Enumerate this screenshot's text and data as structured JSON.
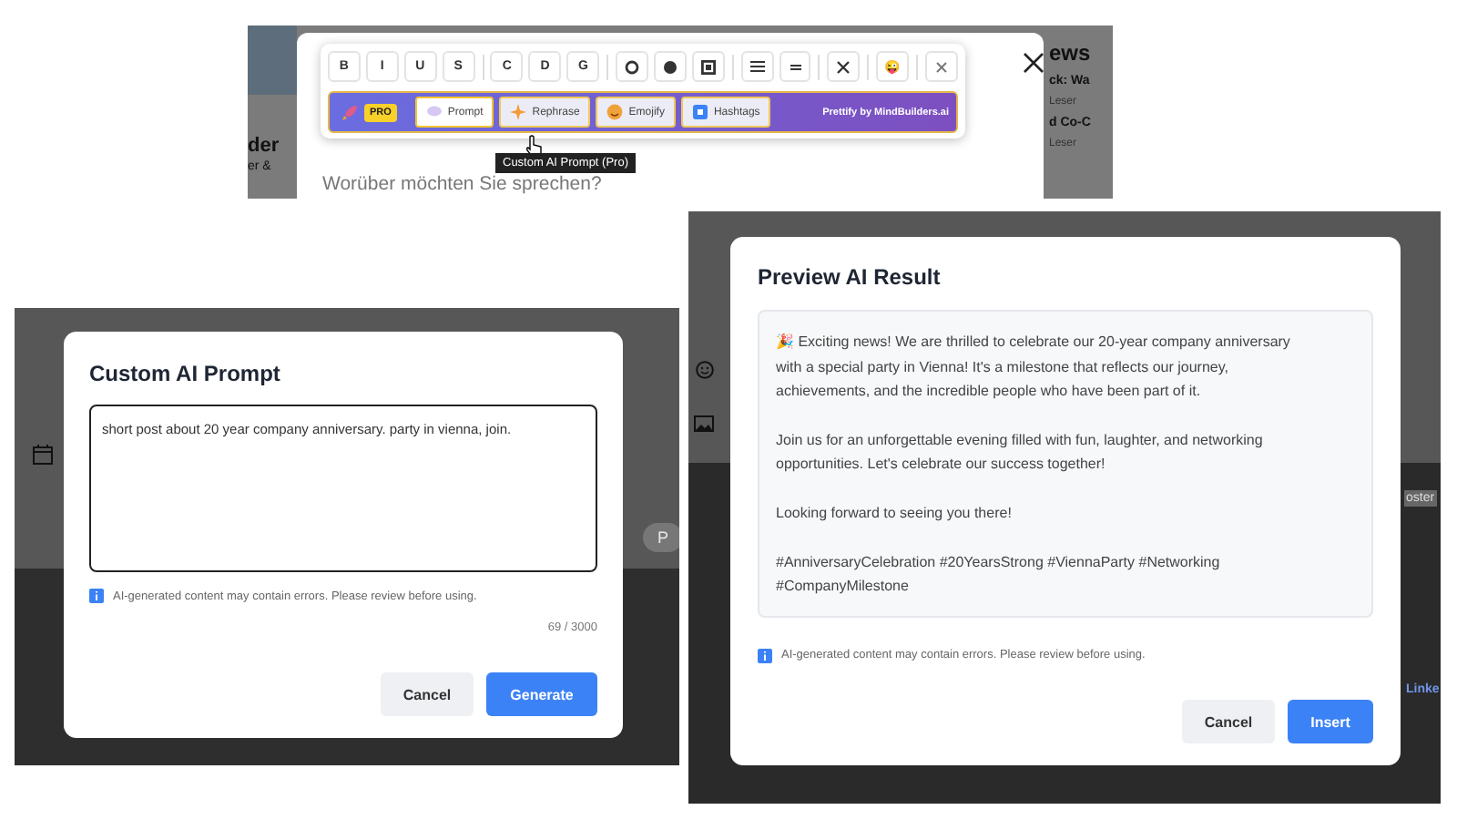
{
  "toolbar_shot": {
    "backdrop_left": [
      "der",
      "er &"
    ],
    "backdrop_right": [
      "ews",
      "ck: Wa",
      "Leser",
      "d Co-C",
      "Leser"
    ],
    "format_groups": [
      [
        {
          "kind": "letter",
          "label": "B"
        },
        {
          "kind": "letter",
          "label": "I"
        },
        {
          "kind": "letter",
          "label": "U"
        },
        {
          "kind": "letter",
          "label": "S"
        }
      ],
      [
        {
          "kind": "letter",
          "label": "C"
        },
        {
          "kind": "letter",
          "label": "D"
        },
        {
          "kind": "letter",
          "label": "G"
        }
      ],
      [
        {
          "kind": "ring"
        },
        {
          "kind": "dot"
        },
        {
          "kind": "square"
        }
      ],
      [
        {
          "kind": "lines"
        },
        {
          "kind": "equals"
        }
      ],
      [
        {
          "kind": "cross"
        }
      ],
      [
        {
          "kind": "emoji",
          "label": "😜"
        }
      ],
      [
        {
          "kind": "close"
        }
      ]
    ],
    "pro_badge": "PRO",
    "ai_buttons": [
      {
        "label": "Prompt",
        "selected": true
      },
      {
        "label": "Rephrase",
        "selected": false
      },
      {
        "label": "Emojify",
        "selected": false
      },
      {
        "label": "Hashtags",
        "selected": false
      }
    ],
    "credit": "Prettify by MindBuilders.ai",
    "tooltip": "Custom AI Prompt (Pro)",
    "placeholder": "Worüber möchten Sie sprechen?"
  },
  "prompt_dialog": {
    "title": "Custom AI Prompt",
    "value": "short post about 20 year company anniversary. party in vienna, join.",
    "note": "AI-generated content may contain errors. Please review before using.",
    "counter": "69 / 3000",
    "backdrop_chip": "P",
    "buttons": [
      {
        "label": "Cancel",
        "kind": "secondary"
      },
      {
        "label": "Generate",
        "kind": "primary"
      }
    ]
  },
  "preview_dialog": {
    "title": "Preview AI Result",
    "paragraphs": [
      "🎉 Exciting news! We are thrilled to celebrate our 20-year company anniversary with a special party in Vienna! It's a milestone that reflects our journey, achievements, and the incredible people who have been part of it.",
      "Join us for an unforgettable evening filled with fun, laughter, and networking opportunities. Let's celebrate our success together!",
      "Looking forward to seeing you there!",
      "#AnniversaryCelebration #20YearsStrong #ViennaParty #Networking #CompanyMilestone"
    ],
    "note": "AI-generated content may contain errors. Please review before using.",
    "backdrop_texts": [
      "oster",
      "Linke"
    ],
    "buttons": [
      {
        "label": "Cancel",
        "kind": "secondary"
      },
      {
        "label": "Insert",
        "kind": "primary"
      }
    ]
  }
}
